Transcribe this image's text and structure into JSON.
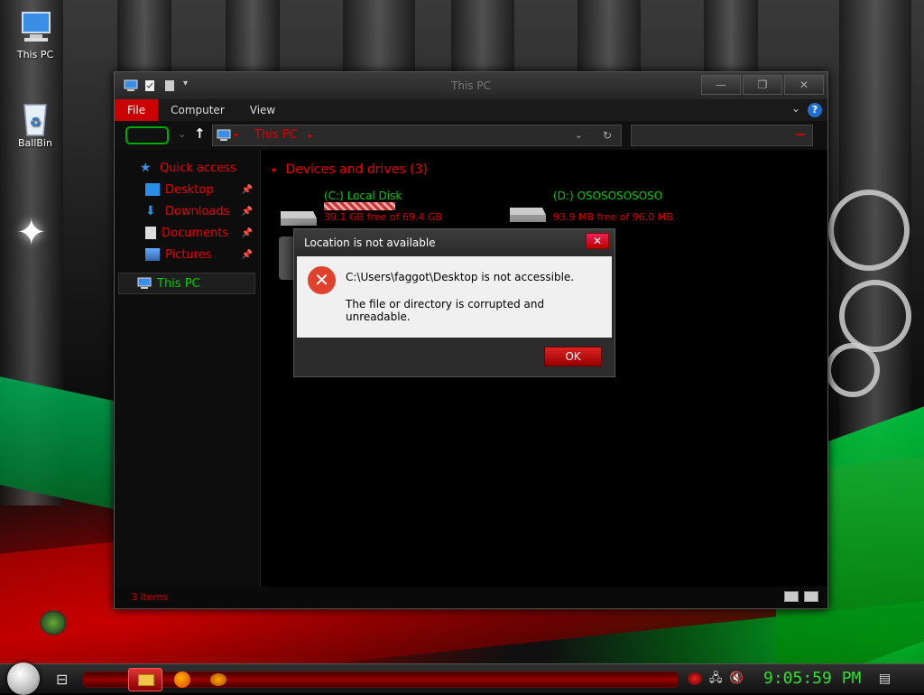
{
  "desktop": {
    "icons": [
      {
        "label": "This PC",
        "icon": "computer-icon"
      },
      {
        "label": "BallBin",
        "icon": "recycle-bin-icon"
      }
    ]
  },
  "explorer": {
    "title": "This PC",
    "ribbon_tabs": [
      "File",
      "Computer",
      "View"
    ],
    "help_label": "?",
    "address": "This PC",
    "nav": {
      "quick_access": "Quick access",
      "items": [
        "Desktop",
        "Downloads",
        "Documents",
        "Pictures"
      ],
      "this_pc": "This PC"
    },
    "group_header": "Devices and drives (3)",
    "drives": [
      {
        "name": "(C:) Local Disk",
        "free": "39.1 GB free of 69.4 GB",
        "used_fraction": 0.44
      },
      {
        "name": "(D:) OSOSOSOSOSO",
        "free": "93.9 MB free of 96.0 MB",
        "used_fraction": 0.02
      }
    ],
    "status": "3 items",
    "window_buttons": [
      "—",
      "❐",
      "✕"
    ]
  },
  "dialog": {
    "title": "Location is not available",
    "close_label": "✕",
    "message1": "C:\\Users\\faggot\\Desktop is not accessible.",
    "message2": "The file or directory is corrupted and unreadable.",
    "ok_label": "OK",
    "error_glyph": "✕"
  },
  "taskbar": {
    "clock": "9:05:59 PM"
  }
}
